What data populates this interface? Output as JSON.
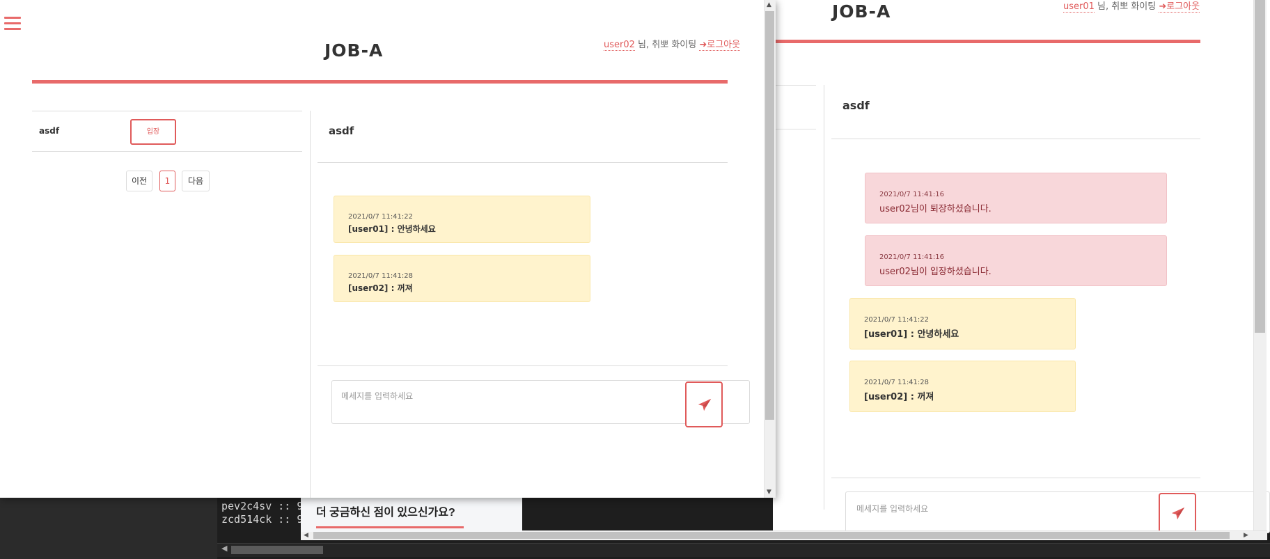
{
  "foreground": {
    "brand": "JOB-A",
    "user_link": "user02",
    "user_suffix": " 님, 취뽀 화이팅 ",
    "logout_label": "로그아웃",
    "room_list": {
      "items": [
        {
          "name": "asdf",
          "enter_label": "입장"
        }
      ],
      "pagination": {
        "prev": "이전",
        "current": "1",
        "next": "다음"
      }
    },
    "chat": {
      "room_title": "asdf",
      "messages": [
        {
          "time": "2021/0/7 11:41:22",
          "text": "[user01] : 안녕하세요"
        },
        {
          "time": "2021/0/7 11:41:28",
          "text": "[user02] : 꺼져"
        }
      ],
      "input_placeholder": "메세지를 입력하세요"
    }
  },
  "background": {
    "brand": "JOB-A",
    "user_link": "user01",
    "user_suffix": " 님, 취뽀 화이팅 ",
    "logout_label": "로그아웃",
    "chat": {
      "room_title": "asdf",
      "messages": [
        {
          "type": "system",
          "time": "2021/0/7 11:41:16",
          "text": "user02님이 퇴장하셨습니다."
        },
        {
          "type": "system",
          "time": "2021/0/7 11:41:16",
          "text": "user02님이 입장하셨습니다."
        },
        {
          "type": "user",
          "time": "2021/0/7 11:41:22",
          "text": "[user01] : 안녕하세요"
        },
        {
          "type": "user",
          "time": "2021/0/7 11:41:28",
          "text": "[user02] : 꺼져"
        }
      ],
      "input_placeholder": "메세지를 입력하세요"
    }
  },
  "faq": {
    "title": "더 궁금하신 점이 있으신가요?"
  },
  "terminal": {
    "lines": [
      "pev2c4sv :: 9",
      "zcd514ck :: 9"
    ]
  },
  "colors": {
    "accent": "#e86a6a",
    "system_message_bg": "#f8d7da",
    "user_message_bg": "#fff3cd"
  },
  "icons": {
    "menu": "hamburger-icon",
    "logout": "sign-out-icon",
    "send": "paper-plane-icon"
  }
}
